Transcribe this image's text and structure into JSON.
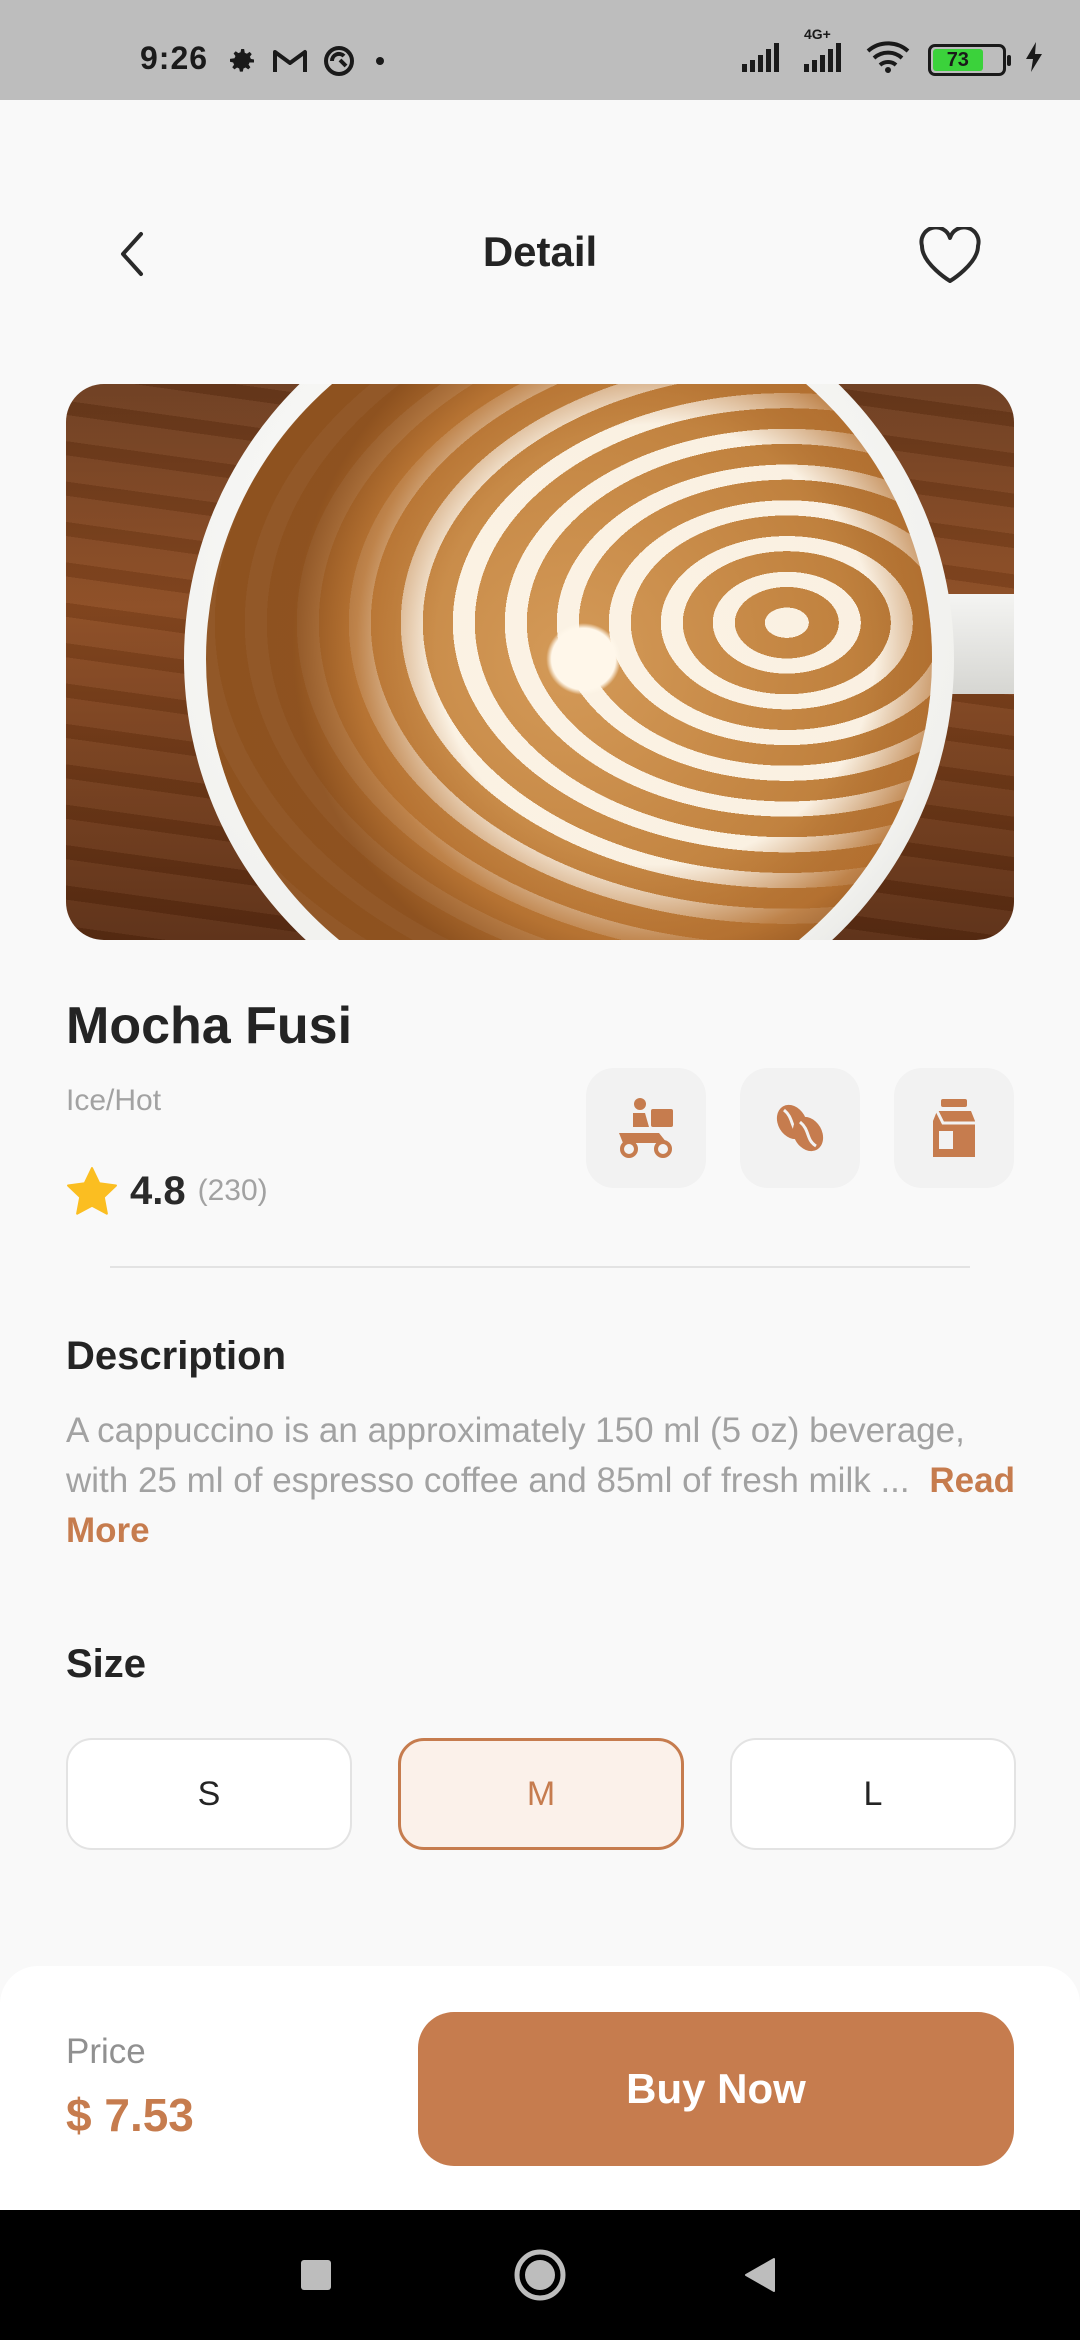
{
  "status_bar": {
    "time": "9:26",
    "network_label": "4G+",
    "battery": "73",
    "icons": [
      "gear-icon",
      "gmail-icon",
      "sync-icon",
      "dot-icon",
      "signal-icon",
      "signal-4g-icon",
      "wifi-icon",
      "battery-icon",
      "charging-icon"
    ]
  },
  "header": {
    "title": "Detail",
    "back_icon": "chevron-left-icon",
    "favorite_icon": "heart-outline-icon"
  },
  "hero_image": {
    "subject": "latte-art-cappuccino-photo"
  },
  "product": {
    "name": "Mocha Fusi",
    "variant": "Ice/Hot",
    "rating": "4.8",
    "rating_count": "(230)",
    "features": [
      {
        "icon": "delivery-scooter-icon"
      },
      {
        "icon": "coffee-bean-icon"
      },
      {
        "icon": "milk-carton-icon"
      }
    ]
  },
  "description": {
    "title": "Description",
    "text": "A cappuccino is an approximately 150 ml (5 oz) beverage, with 25 ml of espresso coffee and 85ml of fresh milk ...",
    "read_more": "Read More"
  },
  "size": {
    "title": "Size",
    "options": [
      {
        "label": "S",
        "selected": false
      },
      {
        "label": "M",
        "selected": true
      },
      {
        "label": "L",
        "selected": false
      }
    ]
  },
  "checkout": {
    "price_label": "Price",
    "price": "$ 7.53",
    "buy_label": "Buy Now"
  },
  "nav_bar": {
    "icons": [
      "recents-square-icon",
      "home-circle-icon",
      "back-triangle-icon"
    ]
  },
  "colors": {
    "accent": "#C67C4E",
    "accent_light": "#FBF1EA",
    "background": "#F9F9F9",
    "text_primary": "#242424",
    "text_secondary": "#A2A2A2",
    "star": "#FBBE21"
  }
}
